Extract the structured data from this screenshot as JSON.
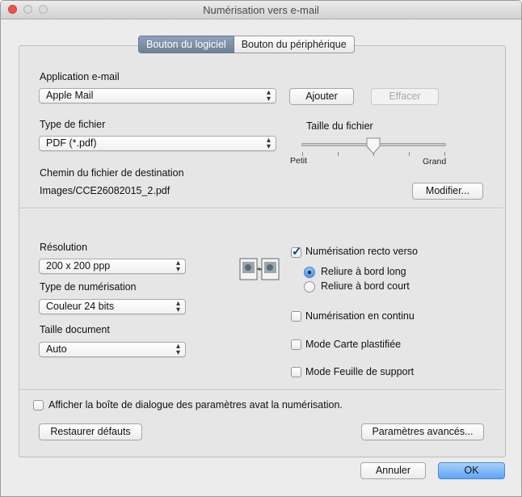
{
  "window": {
    "title": "Numérisation vers e-mail"
  },
  "tabs": [
    {
      "label": "Bouton du logiciel",
      "active": true
    },
    {
      "label": "Bouton du périphérique",
      "active": false
    }
  ],
  "email_app": {
    "label": "Application e-mail",
    "value": "Apple Mail",
    "add_button": "Ajouter",
    "clear_button": "Effacer"
  },
  "file_type": {
    "label": "Type de fichier",
    "value": "PDF (*.pdf)"
  },
  "file_size": {
    "label": "Taille du fichier",
    "min_label": "Petit",
    "max_label": "Grand",
    "level": 0.5
  },
  "destination": {
    "label": "Chemin du fichier de destination",
    "path": "Images/CCE26082015_2.pdf",
    "modify_button": "Modifier..."
  },
  "resolution": {
    "label": "Résolution",
    "value": "200 x 200 ppp"
  },
  "scan_type": {
    "label": "Type de numérisation",
    "value": "Couleur 24 bits"
  },
  "doc_size": {
    "label": "Taille document",
    "value": "Auto"
  },
  "duplex": {
    "label": "Numérisation recto verso",
    "checked": true,
    "options": [
      {
        "label": "Reliure à bord long",
        "selected": true
      },
      {
        "label": "Reliure à bord court",
        "selected": false
      }
    ]
  },
  "continuous": {
    "label": "Numérisation en continu",
    "checked": false
  },
  "card_mode": {
    "label": "Mode Carte plastifiée",
    "checked": false
  },
  "carrier_mode": {
    "label": "Mode Feuille de support",
    "checked": false
  },
  "show_settings": {
    "label": "Afficher la boîte de dialogue des paramètres avat la numérisation.",
    "checked": false
  },
  "buttons": {
    "restore": "Restaurer défauts",
    "advanced": "Paramètres avancés...",
    "cancel": "Annuler",
    "ok": "OK"
  },
  "icons": {
    "duplex_icon": "duplex-scan-icon"
  }
}
